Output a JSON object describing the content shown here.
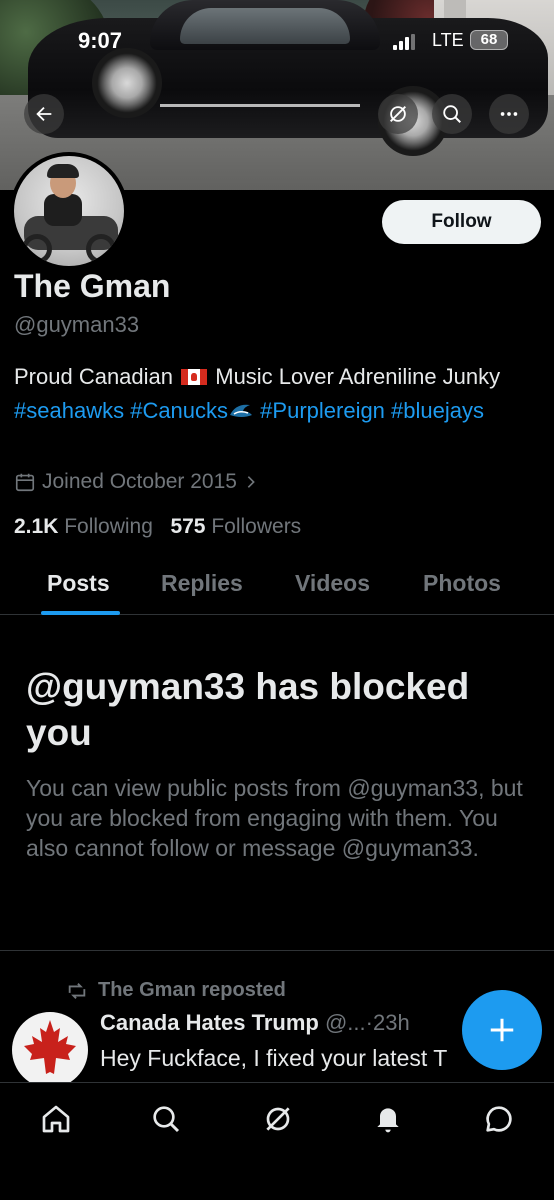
{
  "status_bar": {
    "time": "9:07",
    "network": "LTE",
    "battery": "68"
  },
  "profile": {
    "display_name": "The Gman",
    "handle": "@guyman33",
    "bio_part1": "Proud Canadian ",
    "bio_part2": " Music Lover Adreniline Junky ",
    "tag_seahawks": "#seahawks",
    "tag_canucks": "#Canucks",
    "tag_purplereign": "#Purplereign",
    "tag_bluejays": "#bluejays",
    "joined": "Joined October 2015",
    "following_count": "2.1K",
    "following_label": "Following",
    "followers_count": "575",
    "followers_label": "Followers",
    "follow_button": "Follow"
  },
  "tabs": [
    {
      "label": "Posts",
      "active": true
    },
    {
      "label": "Replies",
      "active": false
    },
    {
      "label": "Videos",
      "active": false
    },
    {
      "label": "Photos",
      "active": false
    }
  ],
  "blocked": {
    "title": "@guyman33 has blocked you",
    "message": "You can view public posts from @guyman33, but you are blocked from engaging with them. You also cannot follow or message @guyman33."
  },
  "post": {
    "repost_label": "The Gman reposted",
    "author_name": "Canada Hates Trump",
    "author_handle": "@...",
    "time": "23h",
    "text": "Hey Fuckface, I fixed your latest T"
  },
  "colors": {
    "accent": "#1d9bf0",
    "background": "#000000",
    "primary_text": "#e7e9ea",
    "secondary_text": "#71767b"
  },
  "icons": {
    "back": "arrow-left-icon",
    "grok": "grok-icon",
    "search": "search-icon",
    "more": "more-icon",
    "calendar": "calendar-icon",
    "repost": "repost-icon",
    "compose": "plus-icon",
    "nav": [
      "home-icon",
      "search-icon",
      "grok-icon",
      "bell-icon",
      "message-icon"
    ]
  }
}
